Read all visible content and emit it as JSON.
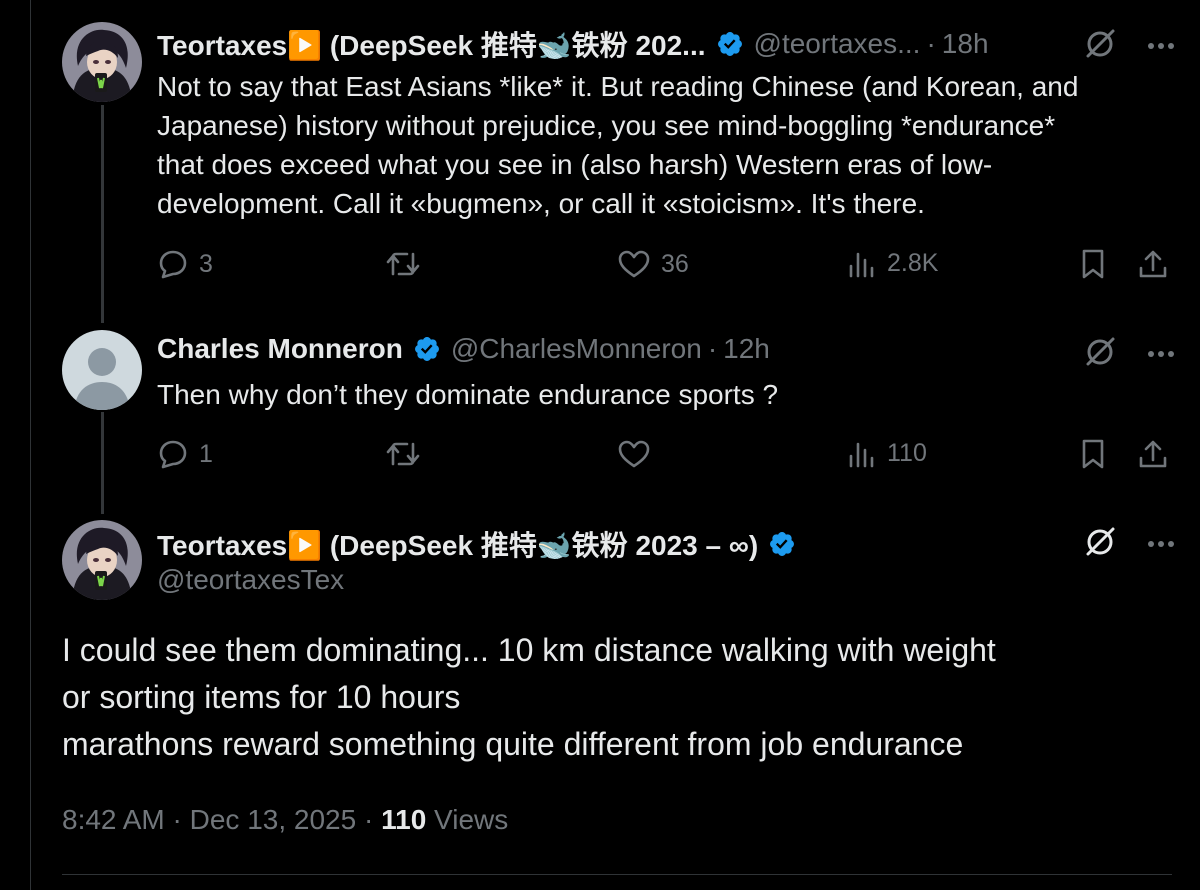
{
  "colors": {
    "background": "#000000",
    "text": "#e7e9ea",
    "muted": "#71767b",
    "verified": "#1d9bf0",
    "divider": "#2f3336"
  },
  "tweet1": {
    "avatar_icon": "anime-avatar",
    "name": "Teortaxes▶️ (DeepSeek 推特🐋铁粉 202...",
    "handle": "@teortaxes...",
    "time": "18h",
    "lines": [
      "Not to say that East Asians *like* it. But reading Chinese (and Korean, and",
      "Japanese) history without prejudice, you see mind-boggling *endurance*",
      "that does exceed what you see in (also harsh) Western eras of low-",
      "development. Call it «bugmen», or call it «stoicism». It's there."
    ],
    "replies": "3",
    "reposts": "",
    "likes": "36",
    "views": "2.8K"
  },
  "tweet2": {
    "avatar_icon": "default-avatar",
    "name": "Charles Monneron",
    "handle": "@CharlesMonneron",
    "time": "12h",
    "lines": [
      "Then why don’t they dominate endurance sports ?"
    ],
    "replies": "1",
    "reposts": "",
    "likes": "",
    "views": "110"
  },
  "tweet3": {
    "avatar_icon": "anime-avatar",
    "name": "Teortaxes▶️ (DeepSeek 推特🐋铁粉 2023 – ∞)",
    "handle": "@teortaxesTex",
    "lines": [
      "I could see them dominating... 10 km distance walking with weight",
      "or sorting items for 10 hours",
      "marathons reward something quite different from job endurance"
    ],
    "time": "8:42 AM",
    "date": "Dec 13, 2025",
    "views_count": "110",
    "views_label": "Views"
  }
}
